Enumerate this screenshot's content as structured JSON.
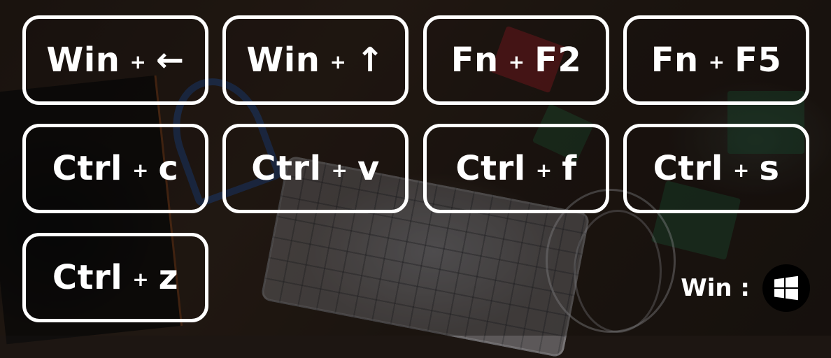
{
  "tiles": [
    {
      "key": "Win",
      "plus": "+",
      "arg": "←"
    },
    {
      "key": "Win",
      "plus": "+",
      "arg": "↑"
    },
    {
      "key": "Fn",
      "plus": "+",
      "arg": "F2"
    },
    {
      "key": "Fn",
      "plus": "+",
      "arg": "F5"
    },
    {
      "key": "Ctrl",
      "plus": "+",
      "arg": "c"
    },
    {
      "key": "Ctrl",
      "plus": "+",
      "arg": "v"
    },
    {
      "key": "Ctrl",
      "plus": "+",
      "arg": "f"
    },
    {
      "key": "Ctrl",
      "plus": "+",
      "arg": "s"
    },
    {
      "key": "Ctrl",
      "plus": "+",
      "arg": "z"
    }
  ],
  "legend": {
    "label": "Win :",
    "icon": "windows-logo-icon"
  },
  "colors": {
    "tile_border": "#ffffff",
    "text": "#ffffff",
    "badge_bg": "#000000"
  }
}
